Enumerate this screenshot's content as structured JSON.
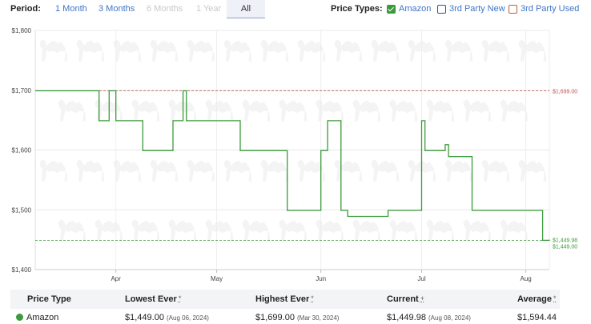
{
  "period": {
    "label": "Period:",
    "options": [
      {
        "label": "1 Month",
        "state": "enabled"
      },
      {
        "label": "3 Months",
        "state": "enabled"
      },
      {
        "label": "6 Months",
        "state": "disabled"
      },
      {
        "label": "1 Year",
        "state": "disabled"
      },
      {
        "label": "All",
        "state": "selected"
      }
    ]
  },
  "price_types": {
    "label": "Price Types:",
    "options": [
      {
        "label": "Amazon",
        "checked": true,
        "color": "#3b9a3b"
      },
      {
        "label": "3rd Party New",
        "checked": false,
        "color": "#2f4f8f"
      },
      {
        "label": "3rd Party Used",
        "checked": false,
        "color": "#b5603a"
      }
    ]
  },
  "chart_data": {
    "type": "line",
    "step": true,
    "y_ticks": [
      "$1,800",
      "$1,700",
      "$1,600",
      "$1,500",
      "$1,400"
    ],
    "ylim": [
      1400,
      1800
    ],
    "x_ticks": [
      {
        "label": "Apr",
        "date": "2024-04-01"
      },
      {
        "label": "May",
        "date": "2024-05-01"
      },
      {
        "label": "Jun",
        "date": "2024-06-01"
      },
      {
        "label": "Jul",
        "date": "2024-07-01"
      },
      {
        "label": "Aug",
        "date": "2024-08-01"
      }
    ],
    "xlim": [
      "2024-03-08",
      "2024-08-08"
    ],
    "grid": true,
    "series": [
      {
        "name": "Amazon",
        "color": "#3b9a3b",
        "points": [
          [
            "2024-03-08",
            1699.0
          ],
          [
            "2024-03-27",
            1649.0
          ],
          [
            "2024-03-30",
            1699.0
          ],
          [
            "2024-04-01",
            1649.0
          ],
          [
            "2024-04-09",
            1599.0
          ],
          [
            "2024-04-18",
            1649.0
          ],
          [
            "2024-04-21",
            1699.0
          ],
          [
            "2024-04-22",
            1649.0
          ],
          [
            "2024-05-08",
            1599.0
          ],
          [
            "2024-05-22",
            1499.0
          ],
          [
            "2024-06-01",
            1599.0
          ],
          [
            "2024-06-03",
            1649.0
          ],
          [
            "2024-06-07",
            1499.0
          ],
          [
            "2024-06-09",
            1489.0
          ],
          [
            "2024-06-21",
            1499.0
          ],
          [
            "2024-07-01",
            1649.0
          ],
          [
            "2024-07-02",
            1599.0
          ],
          [
            "2024-07-08",
            1609.0
          ],
          [
            "2024-07-09",
            1589.0
          ],
          [
            "2024-07-16",
            1499.0
          ],
          [
            "2024-08-06",
            1449.0
          ],
          [
            "2024-08-08",
            1449.98
          ]
        ]
      }
    ],
    "reference_lines": [
      {
        "label": "$1,699.00",
        "value": 1699.0,
        "color": "#c0504d"
      },
      {
        "label": "$1,449.00",
        "value": 1449.0,
        "color": "#3b9a3b"
      }
    ],
    "current_label": {
      "label": "$1,449.98",
      "value": 1449.98,
      "color": "#3b9a3b"
    }
  },
  "table": {
    "headers": {
      "price_type": "Price Type",
      "lowest": "Lowest Ever",
      "highest": "Highest Ever",
      "current": "Current",
      "average": "Average"
    },
    "header_marks": {
      "lowest": "*",
      "highest": "*",
      "current": "+",
      "average": "*"
    },
    "rows": [
      {
        "name": "Amazon",
        "color": "#3b9a3b",
        "lowest": "$1,449.00",
        "lowest_date": "(Aug 06, 2024)",
        "highest": "$1,699.00",
        "highest_date": "(Mar 30, 2024)",
        "current": "$1,449.98",
        "current_date": "(Aug 08, 2024)",
        "average": "$1,594.44"
      }
    ]
  }
}
